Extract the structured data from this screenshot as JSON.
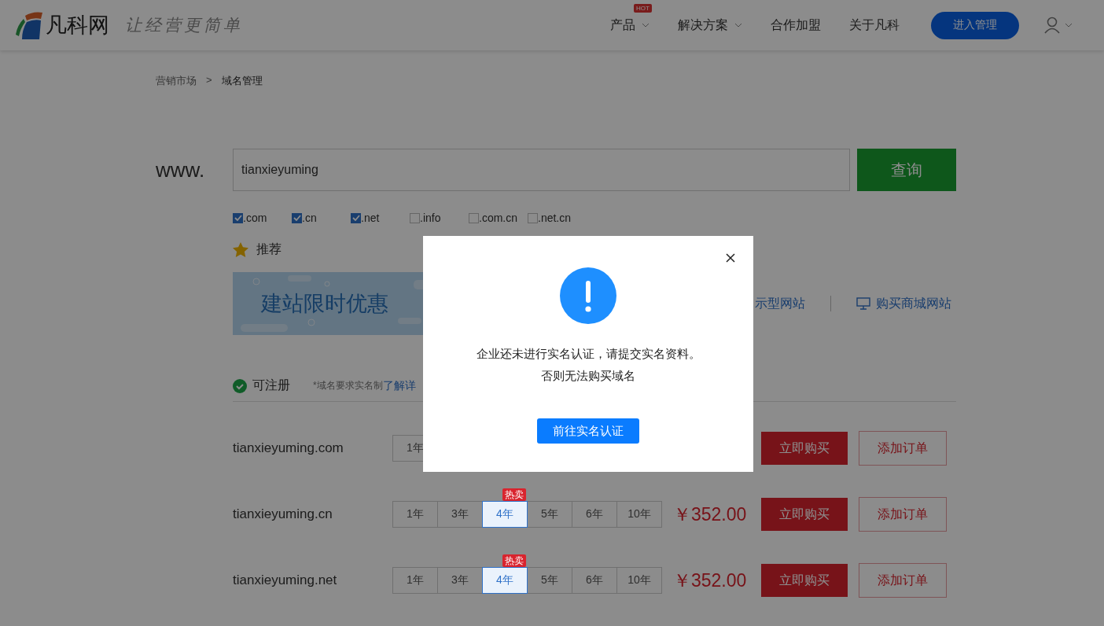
{
  "header": {
    "logo_text": "凡科网",
    "slogan": "让经营更简单",
    "nav": [
      {
        "label": "产品",
        "badge": "HOT",
        "dropdown": true
      },
      {
        "label": "解决方案",
        "dropdown": true
      },
      {
        "label": "合作加盟",
        "dropdown": false
      },
      {
        "label": "关于凡科",
        "dropdown": false
      }
    ],
    "manage_button": "进入管理"
  },
  "breadcrumb": {
    "items": [
      "营销市场",
      "域名管理"
    ],
    "separator": ">"
  },
  "search": {
    "prefix": "www.",
    "value": "tianxieyuming",
    "button": "查询"
  },
  "suffixes": [
    {
      "label": ".com",
      "checked": true
    },
    {
      "label": ".cn",
      "checked": true
    },
    {
      "label": ".net",
      "checked": true
    },
    {
      "label": ".info",
      "checked": false
    },
    {
      "label": ".com.cn",
      "checked": false
    },
    {
      "label": ".net.cn",
      "checked": false
    }
  ],
  "recommend": {
    "title": "推荐",
    "banner_title": "建站限时优惠",
    "links": [
      "示型网站",
      "购买商城网站"
    ]
  },
  "available": {
    "title": "可注册",
    "note": "*域名要求实名制",
    "link": "了解详"
  },
  "results": [
    {
      "domain": "tianxieyuming.com",
      "years": [
        {
          "label": "1年",
          "selected": false
        }
      ],
      "buy": "立即购买",
      "add": "添加订单"
    },
    {
      "domain": "tianxieyuming.cn",
      "years": [
        {
          "label": "1年",
          "selected": false
        },
        {
          "label": "3年",
          "selected": false
        },
        {
          "label": "4年",
          "selected": true,
          "badge": "热卖"
        },
        {
          "label": "5年",
          "selected": false
        },
        {
          "label": "6年",
          "selected": false
        },
        {
          "label": "10年",
          "selected": false
        }
      ],
      "price": "￥352.00",
      "buy": "立即购买",
      "add": "添加订单"
    },
    {
      "domain": "tianxieyuming.net",
      "years": [
        {
          "label": "1年",
          "selected": false
        },
        {
          "label": "3年",
          "selected": false
        },
        {
          "label": "4年",
          "selected": true,
          "badge": "热卖"
        },
        {
          "label": "5年",
          "selected": false
        },
        {
          "label": "6年",
          "selected": false
        },
        {
          "label": "10年",
          "selected": false
        }
      ],
      "price": "￥352.00",
      "buy": "立即购买",
      "add": "添加订单"
    }
  ],
  "modal": {
    "lines": [
      "企业还未进行实名认证，请提交实名资料。",
      "否则无法购买域名"
    ],
    "button": "前往实名认证"
  }
}
